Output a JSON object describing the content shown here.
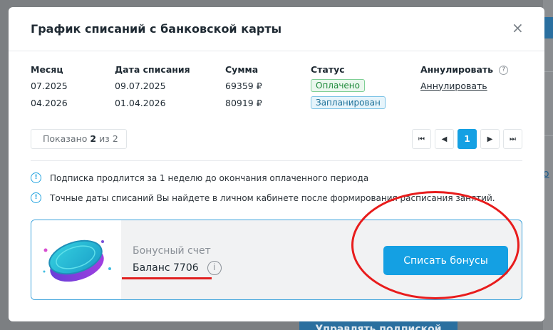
{
  "modal": {
    "title": "График списаний с банковской карты",
    "close_icon": "×"
  },
  "table": {
    "headers": [
      "Месяц",
      "Дата списания",
      "Сумма",
      "Статус",
      "Аннулировать"
    ],
    "help_icon": "?",
    "rows": [
      {
        "month": "07.2025",
        "date": "09.07.2025",
        "amount": "69359 ₽",
        "status": "Оплачено",
        "annul": "Аннулировать"
      },
      {
        "month": "04.2026",
        "date": "01.04.2026",
        "amount": "80919 ₽",
        "status": "Запланирован",
        "annul": ""
      }
    ]
  },
  "pagination": {
    "shown_prefix": "Показано",
    "shown_count": "2",
    "shown_of": "из",
    "shown_total": "2",
    "first": "⏮",
    "prev": "◀",
    "current": "1",
    "next": "▶",
    "last": "⏭"
  },
  "notes": [
    "Подписка продлится за 1 неделю до окончания оплаченного периода",
    "Точные даты списаний Вы найдете в личном кабинете после формирования расписания занятий."
  ],
  "bonus": {
    "label": "Бонусный счет",
    "balance": "Баланс 7706",
    "button": "Списать бонусы",
    "info_icon": "i"
  },
  "background": {
    "bottom_button": "Управлять подпиской",
    "right_link": "о"
  },
  "colors": {
    "accent": "#14a0e3",
    "paid": "#1f8a3b",
    "planned": "#1b6f98",
    "annotation_red": "#e81c1c"
  }
}
